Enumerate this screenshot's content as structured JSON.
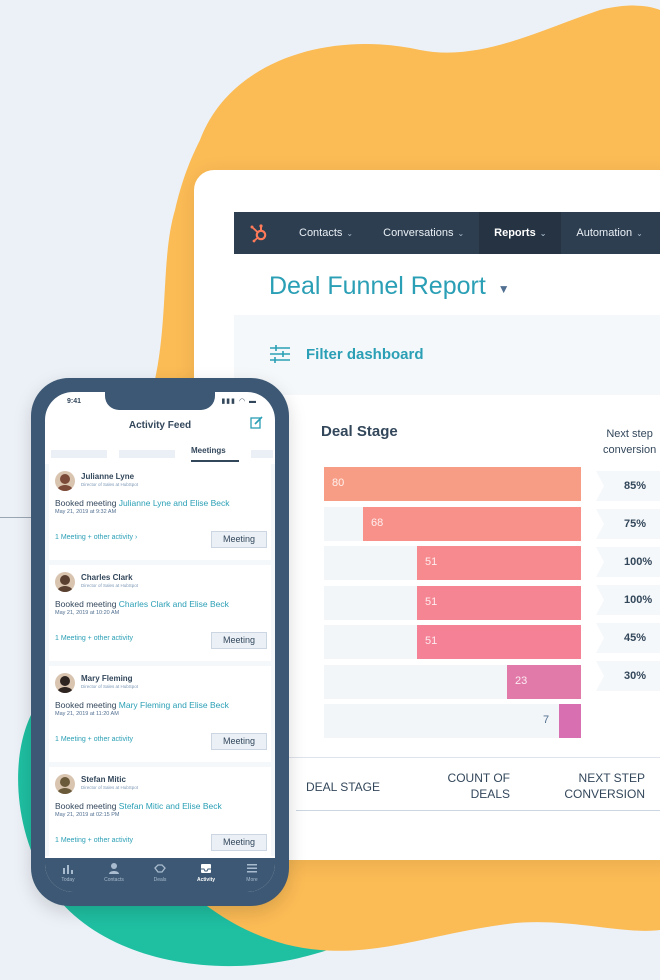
{
  "colors": {
    "background": "#ecf1f7",
    "blob_orange": "#fbbb55",
    "blob_teal": "#1fbfa2",
    "nav_bg": "#2d3e50",
    "brand_orange": "#ff7a59",
    "teal_text": "#2a9fb5",
    "phone_frame": "#3d5874"
  },
  "desktop": {
    "nav": {
      "logo_icon": "hubspot-sprocket-icon",
      "items": [
        {
          "label": "Contacts",
          "active": false
        },
        {
          "label": "Conversations",
          "active": false
        },
        {
          "label": "Reports",
          "active": true
        },
        {
          "label": "Automation",
          "active": false
        }
      ]
    },
    "report_title": "Deal Funnel Report",
    "filter_label": "Filter dashboard",
    "chart": {
      "deal_stage_heading": "Deal Stage",
      "next_step_heading_line1": "Next step",
      "next_step_heading_line2": "conversion",
      "bars": [
        {
          "value": 80,
          "label": "80",
          "color": "#f89d85"
        },
        {
          "value": 68,
          "label": "68",
          "color": "#f8918a"
        },
        {
          "value": 51,
          "label": "51",
          "color": "#f68a8f"
        },
        {
          "value": 51,
          "label": "51",
          "color": "#f58592"
        },
        {
          "value": 51,
          "label": "51",
          "color": "#f48196"
        },
        {
          "value": 23,
          "label": "23",
          "color": "#e27aa9"
        },
        {
          "value": 7,
          "label": "7",
          "color": "#d76fb0"
        }
      ],
      "conversions": [
        "85%",
        "75%",
        "100%",
        "100%",
        "45%",
        "30%"
      ]
    },
    "table": {
      "col1": "DEAL STAGE",
      "col2_line1": "COUNT OF",
      "col2_line2": "DEALS",
      "col3_line1": "NEXT STEP",
      "col3_line2": "CONVERSION"
    }
  },
  "phone": {
    "status_time": "9:41",
    "title": "Activity Feed",
    "compose_icon": "compose-icon",
    "active_tab": "Meetings",
    "cards": [
      {
        "name": "Julianne Lyne",
        "role": "Director of Sales at HubSpot",
        "action_prefix": "Booked meeting ",
        "action_link": "Julianne Lyne and Elise Beck",
        "date": "May 21, 2019 at 9:32 AM",
        "more": "1 Meeting + other activity ›",
        "button": "Meeting",
        "avatar_color": "#7b4a38"
      },
      {
        "name": "Charles Clark",
        "role": "Director of Sales at HubSpot",
        "action_prefix": "Booked meeting ",
        "action_link": "Charles Clark and Elise Beck",
        "date": "May 21, 2019 at 10:20 AM",
        "more": "1 Meeting + other activity",
        "button": "Meeting",
        "avatar_color": "#5a4030"
      },
      {
        "name": "Mary Fleming",
        "role": "Director of Sales at HubSpot",
        "action_prefix": "Booked meeting ",
        "action_link": "Mary Fleming and Elise Beck",
        "date": "May 21, 2019 at 11:20 AM",
        "more": "1 Meeting + other activity",
        "button": "Meeting",
        "avatar_color": "#2e2420"
      },
      {
        "name": "Stefan Mitic",
        "role": "Director of Sales at HubSpot",
        "action_prefix": "Booked meeting ",
        "action_link": "Stefan Mitic and Elise Beck",
        "date": "May 21, 2019 at 02:15 PM",
        "more": "1 Meeting + other activity",
        "button": "Meeting",
        "avatar_color": "#6b5a3a"
      }
    ],
    "tabbar": [
      {
        "label": "Today",
        "icon": "bar-chart-icon",
        "active": false
      },
      {
        "label": "Contacts",
        "icon": "person-icon",
        "active": false
      },
      {
        "label": "Deals",
        "icon": "handshake-icon",
        "active": false
      },
      {
        "label": "Activity",
        "icon": "inbox-icon",
        "active": true
      },
      {
        "label": "More",
        "icon": "menu-icon",
        "active": false
      }
    ]
  }
}
